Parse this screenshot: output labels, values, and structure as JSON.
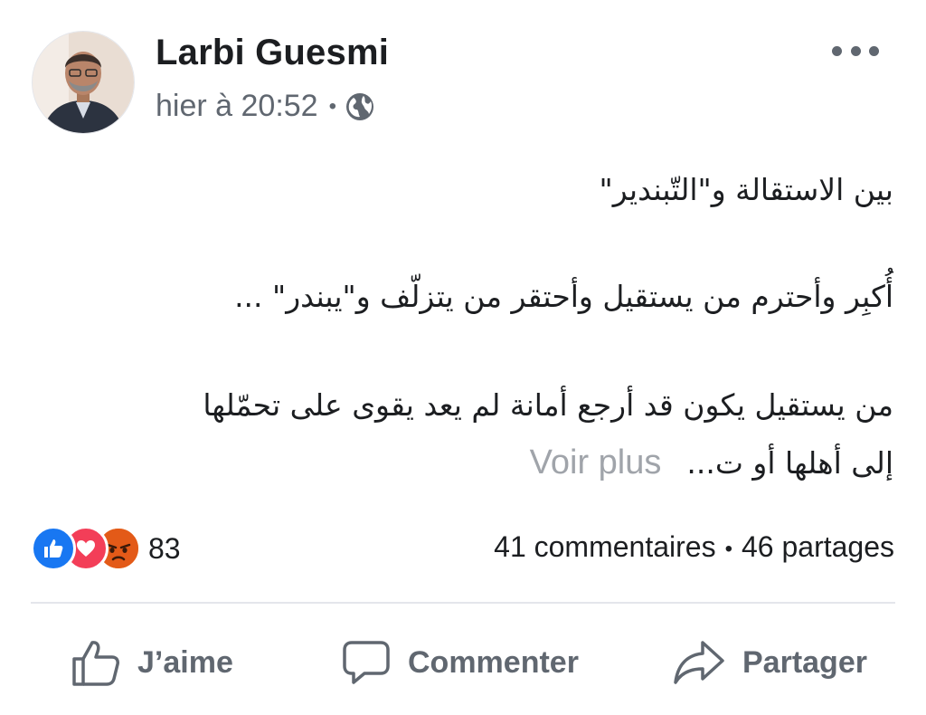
{
  "post": {
    "author": "Larbi Guesmi",
    "timestamp": "hier à 20:52",
    "meta_separator": "•",
    "privacy_icon": "globe-icon",
    "more_icon": "more-horizontal-icon",
    "body_lines": [
      "بين الاستقالة و\"التّبندير\"",
      "أُكبِر وأحترم من يستقيل وأحتقر من يتزلّف و\"يبندر\" ...",
      "",
      "من يستقيل يكون قد أرجع أمانة لم يعد يقوى على تحمّلها",
      "إلى أهلها أو ت..."
    ],
    "see_more": "Voir plus"
  },
  "engagement": {
    "reaction_icons": [
      "like-icon",
      "love-icon",
      "angry-icon"
    ],
    "reaction_count": "83",
    "comments": "41 commentaires",
    "separator": "•",
    "shares": "46 partages"
  },
  "actions": {
    "like": "J’aime",
    "comment": "Commenter",
    "share": "Partager"
  },
  "colors": {
    "like_blue": "#1877f2",
    "love_red": "#f33e58",
    "angry_orange": "#e9710f",
    "secondary_text": "#606770",
    "see_more_gray": "#a0a4aa"
  }
}
